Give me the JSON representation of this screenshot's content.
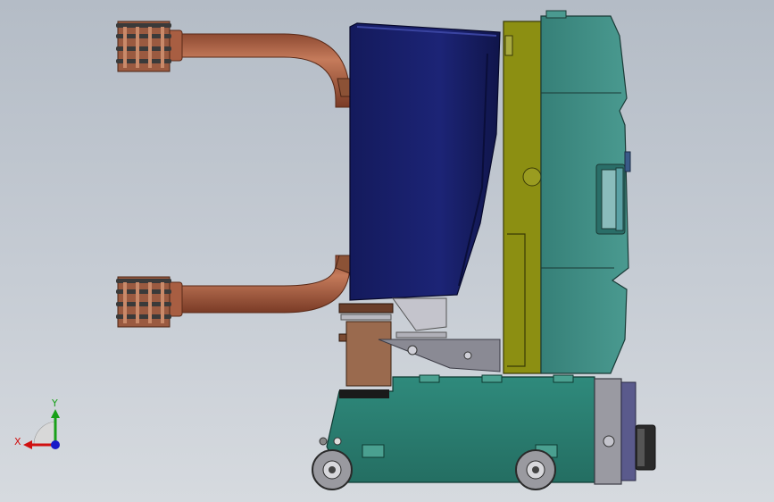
{
  "triad": {
    "x_label": "X",
    "y_label": "Y",
    "x_color": "#d01010",
    "y_color": "#18a018",
    "z_color": "#1818c8"
  },
  "colors": {
    "copper": "#b86a4c",
    "navy_housing": "#1a1f6e",
    "olive_plate": "#8a8c10",
    "teal_body": "#3e8c84",
    "teal_base": "#2c7c70",
    "gray_metal": "#9a9aa2"
  }
}
